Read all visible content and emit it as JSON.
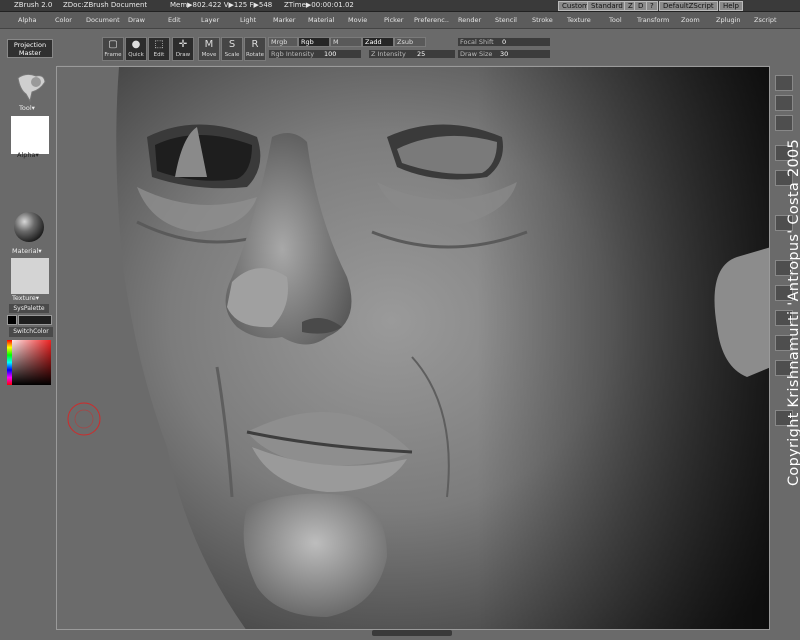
{
  "titlebar": {
    "app": "ZBrush 2.0",
    "doc": "ZDoc:ZBrush Document",
    "mem": "Mem▶802.422 V▶125 F▶548",
    "ztime": "ZTime▶00:00:01.02",
    "buttons": [
      "Custom",
      "Standard",
      "Z",
      "D",
      "?",
      "DefaultZScript",
      "Help"
    ]
  },
  "menu": [
    "Alpha",
    "Color",
    "Document",
    "Draw",
    "Edit",
    "Layer",
    "Light",
    "Marker",
    "Material",
    "Movie",
    "Picker",
    "Preferenc..",
    "Render",
    "Stencil",
    "Stroke",
    "Texture",
    "Tool",
    "Transform",
    "Zoom",
    "Zplugin",
    "Zscript"
  ],
  "toolbar": {
    "projection_master": "Projection Master",
    "tools": [
      {
        "label": "Frame",
        "icon": "frame-icon",
        "glyph": "▢",
        "active": false
      },
      {
        "label": "Quick",
        "icon": "quick-sphere-icon",
        "glyph": "●",
        "active": true
      },
      {
        "label": "Edit",
        "icon": "edit-icon",
        "glyph": "⬚",
        "active": true
      },
      {
        "label": "Draw",
        "icon": "draw-icon",
        "glyph": "✛",
        "active": true
      },
      {
        "label": "Move",
        "icon": "move-icon",
        "glyph": "M",
        "active": false
      },
      {
        "label": "Scale",
        "icon": "scale-icon",
        "glyph": "S",
        "active": false
      },
      {
        "label": "Rotate",
        "icon": "rotate-icon",
        "glyph": "R",
        "active": false
      }
    ],
    "mrgb": "Mrgb",
    "rgb": "Rgb",
    "m": "M",
    "zadd": "Zadd",
    "zsub": "Zsub",
    "rgb_intensity_label": "Rgb Intensity",
    "rgb_intensity_value": "100",
    "z_intensity_label": "Z Intensity",
    "z_intensity_value": "25",
    "focal_shift_label": "Focal Shift",
    "focal_shift_value": "0",
    "draw_size_label": "Draw Size",
    "draw_size_value": "30"
  },
  "left_panel": {
    "tool_label": "Tool▾",
    "alpha_label": "Alpha▾",
    "material_label": "Material▾",
    "texture_label": "Texture▾",
    "syspalette": "SysPalette",
    "switchcolor": "SwitchColor"
  },
  "canvas": {
    "copyright": "Copyright Krishnamurti 'Antropus' Costa 2005"
  },
  "colors": {
    "brush_cursor": "#d02a2a",
    "canvas_bg": "#6b6b6b"
  }
}
